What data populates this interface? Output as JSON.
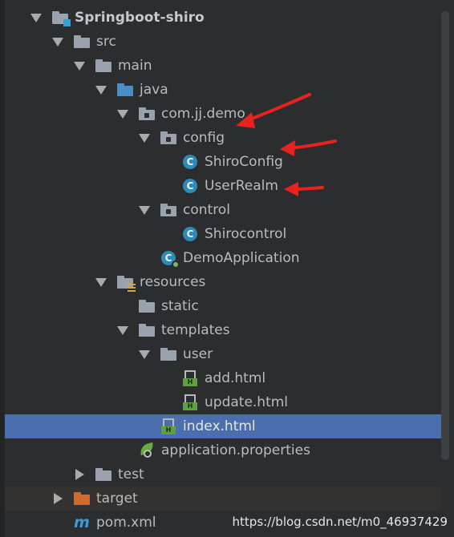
{
  "project_tree": {
    "items": [
      {
        "label": "Springboot-shiro",
        "icon": "module-folder-icon",
        "state": "expanded"
      },
      {
        "label": "src",
        "icon": "folder-icon",
        "state": "expanded"
      },
      {
        "label": "main",
        "icon": "folder-icon",
        "state": "expanded"
      },
      {
        "label": "java",
        "icon": "source-folder-icon",
        "state": "expanded"
      },
      {
        "label": "com.jj.demo",
        "icon": "package-icon",
        "state": "expanded"
      },
      {
        "label": "config",
        "icon": "package-icon",
        "state": "expanded"
      },
      {
        "label": "ShiroConfig",
        "icon": "java-class-icon"
      },
      {
        "label": "UserRealm",
        "icon": "java-class-icon"
      },
      {
        "label": "control",
        "icon": "package-icon",
        "state": "expanded"
      },
      {
        "label": "Shirocontrol",
        "icon": "java-class-icon"
      },
      {
        "label": "DemoApplication",
        "icon": "spring-boot-class-icon"
      },
      {
        "label": "resources",
        "icon": "resources-folder-icon",
        "state": "expanded"
      },
      {
        "label": "static",
        "icon": "folder-icon"
      },
      {
        "label": "templates",
        "icon": "folder-icon",
        "state": "expanded"
      },
      {
        "label": "user",
        "icon": "folder-icon",
        "state": "expanded"
      },
      {
        "label": "add.html",
        "icon": "html-file-icon"
      },
      {
        "label": "update.html",
        "icon": "html-file-icon"
      },
      {
        "label": "index.html",
        "icon": "html-file-icon",
        "selected": true
      },
      {
        "label": "application.properties",
        "icon": "spring-properties-icon"
      },
      {
        "label": "test",
        "icon": "folder-icon",
        "state": "collapsed"
      },
      {
        "label": "target",
        "icon": "excluded-folder-icon",
        "state": "collapsed"
      },
      {
        "label": "pom.xml",
        "icon": "maven-icon"
      }
    ]
  },
  "icon_glyphs": {
    "java_class": "C",
    "html_badge": "H",
    "maven": "m"
  },
  "watermark": "https://blog.csdn.net/m0_46937429",
  "colors": {
    "background": "#2b2d2f",
    "selection": "#4b6eaf",
    "text": "#bbbbbb",
    "annotation_arrow": "#e8231f",
    "class_icon": "#2f8ab8",
    "html_badge": "#5fa043",
    "excluded_folder": "#d06b2c"
  }
}
